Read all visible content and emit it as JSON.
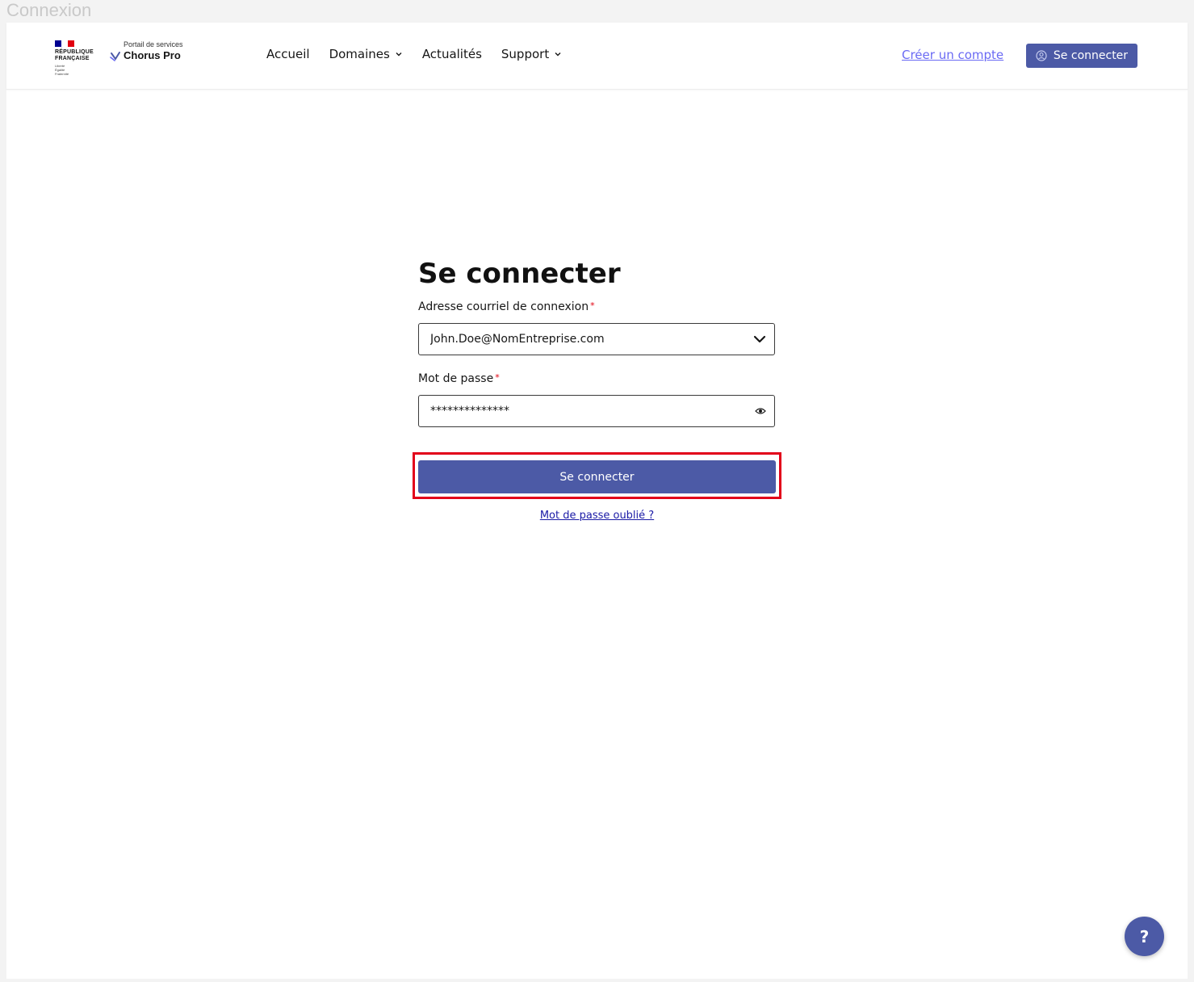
{
  "window": {
    "title": "Connexion"
  },
  "header": {
    "logo": {
      "line1": "RÉPUBLIQUE",
      "line2": "FRANÇAISE",
      "motto": [
        "Liberté",
        "Égalité",
        "Fraternité"
      ]
    },
    "service": {
      "tagline": "Portail de services",
      "name": "Chorus Pro"
    },
    "nav": [
      {
        "label": "Accueil",
        "has_dropdown": false
      },
      {
        "label": "Domaines",
        "has_dropdown": true
      },
      {
        "label": "Actualités",
        "has_dropdown": false
      },
      {
        "label": "Support",
        "has_dropdown": true
      }
    ],
    "create_account_label": "Créer un compte",
    "login_button_label": "Se connecter"
  },
  "form": {
    "title": "Se connecter",
    "email": {
      "label": "Adresse courriel de connexion",
      "required_mark": "*",
      "value": "John.Doe@NomEntreprise.com"
    },
    "password": {
      "label": "Mot de passe",
      "required_mark": "*",
      "value": "**************"
    },
    "submit_label": "Se connecter",
    "forgot_password_label": "Mot de passe oublié ?"
  },
  "help_button_label": "?",
  "colors": {
    "primary": "#4c5aa6",
    "link": "#6a6af4",
    "highlight": "#e2001a",
    "required": "#e1000f"
  }
}
